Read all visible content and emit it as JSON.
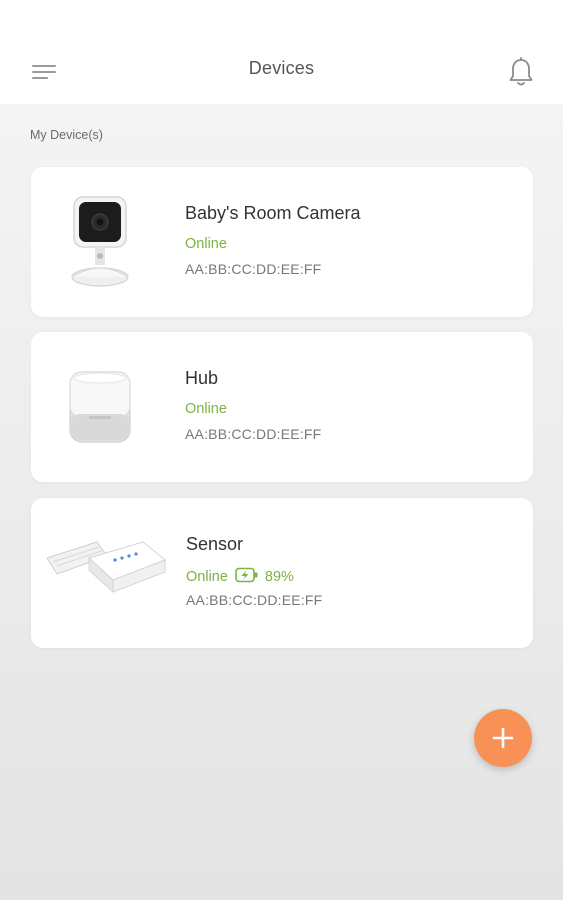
{
  "header": {
    "title": "Devices",
    "menu_icon": "hamburger-menu-icon",
    "notification_icon": "bell-icon"
  },
  "section": {
    "label": "My Device(s)"
  },
  "devices": [
    {
      "name": "Baby's Room Camera",
      "status": "Online",
      "mac": "AA:BB:CC:DD:EE:FF",
      "image": "camera-image"
    },
    {
      "name": "Hub",
      "status": "Online",
      "mac": "AA:BB:CC:DD:EE:FF",
      "image": "hub-image"
    },
    {
      "name": "Sensor",
      "status": "Online",
      "battery": "89%",
      "mac": "AA:BB:CC:DD:EE:FF",
      "image": "sensor-image"
    }
  ],
  "fab": {
    "icon": "plus-icon"
  },
  "colors": {
    "online": "#7cb342",
    "fab": "#f79155",
    "header_bg": "#ffffff",
    "card_bg": "#ffffff"
  }
}
